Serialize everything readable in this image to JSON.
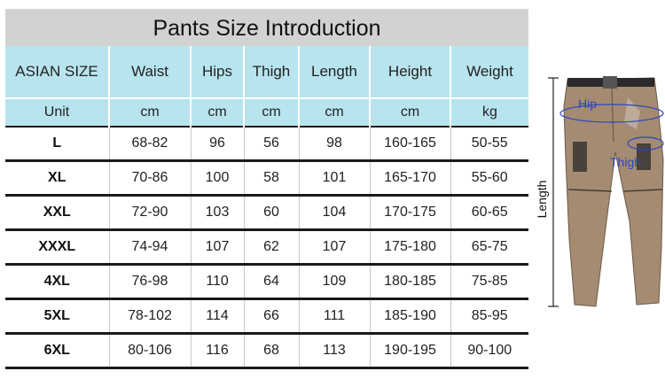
{
  "title": "Pants Size Introduction",
  "headers": [
    "ASIAN SIZE",
    "Waist",
    "Hips",
    "Thigh",
    "Length",
    "Height",
    "Weight"
  ],
  "units": [
    "Unit",
    "cm",
    "cm",
    "cm",
    "cm",
    "cm",
    "kg"
  ],
  "rows": [
    [
      "L",
      "68-82",
      "96",
      "56",
      "98",
      "160-165",
      "50-55"
    ],
    [
      "XL",
      "70-86",
      "100",
      "58",
      "101",
      "165-170",
      "55-60"
    ],
    [
      "XXL",
      "72-90",
      "103",
      "60",
      "104",
      "170-175",
      "60-65"
    ],
    [
      "XXXL",
      "74-94",
      "107",
      "62",
      "107",
      "175-180",
      "65-75"
    ],
    [
      "4XL",
      "76-98",
      "110",
      "64",
      "109",
      "180-185",
      "75-85"
    ],
    [
      "5XL",
      "78-102",
      "114",
      "66",
      "111",
      "185-190",
      "85-95"
    ],
    [
      "6XL",
      "80-106",
      "116",
      "68",
      "113",
      "190-195",
      "90-100"
    ]
  ],
  "figure": {
    "length_label": "Length",
    "hip_label": "Hip",
    "thigh_label": "Thigh",
    "pants_color": "#a48b72",
    "label_color": "#2b45c8"
  }
}
